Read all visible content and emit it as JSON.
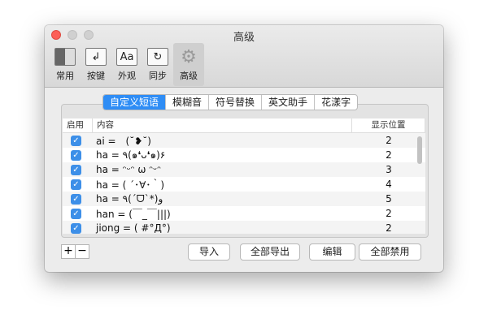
{
  "window": {
    "title": "高级"
  },
  "toolbar": [
    {
      "label": "常用",
      "icon": "general-icon"
    },
    {
      "label": "按键",
      "icon": "keys-icon"
    },
    {
      "label": "外观",
      "icon": "Aa"
    },
    {
      "label": "同步",
      "icon": "sync-icon"
    },
    {
      "label": "高级",
      "icon": "gear-icon",
      "selected": true
    }
  ],
  "tabs": [
    "自定义短语",
    "模糊音",
    "符号替换",
    "英文助手",
    "花漾字"
  ],
  "table": {
    "headers": [
      "启用",
      "内容",
      "显示位置"
    ],
    "rows": [
      {
        "enabled": true,
        "content": "ai =　(˘❥˘)",
        "pos": "2"
      },
      {
        "enabled": true,
        "content": "ha = ٩(๑❛ᴗ❛๑)۶",
        "pos": "2"
      },
      {
        "enabled": true,
        "content": "ha = ᵔᵕᵔ ω ᵔᵕᵔ",
        "pos": "3"
      },
      {
        "enabled": true,
        "content": "ha = ( ´･∀･｀)",
        "pos": "4"
      },
      {
        "enabled": true,
        "content": "ha = ٩(ˊᗜˋ*)و",
        "pos": "5"
      },
      {
        "enabled": true,
        "content": "han = (￣_￣|||)",
        "pos": "2"
      },
      {
        "enabled": true,
        "content": "jiong = ( #°Д°)",
        "pos": "2"
      }
    ]
  },
  "buttons": {
    "add": "+",
    "remove": "−",
    "import": "导入",
    "export_all": "全部导出",
    "edit": "编辑",
    "disable_all": "全部禁用"
  }
}
